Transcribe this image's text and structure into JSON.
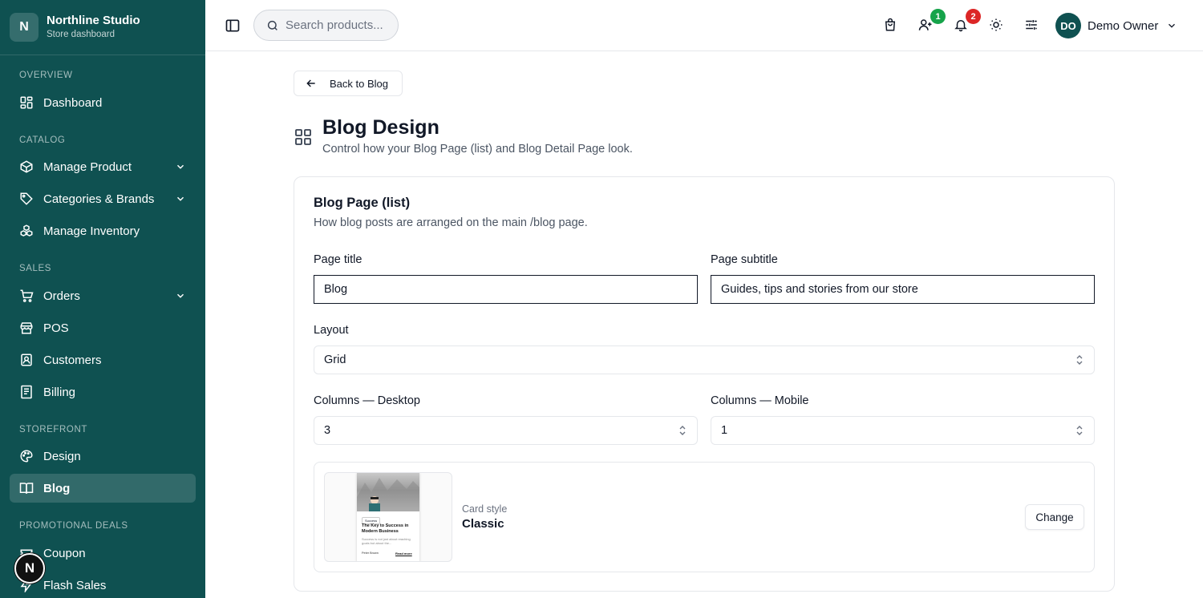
{
  "brand": {
    "logo_letter": "N",
    "name": "Northline Studio",
    "subtitle": "Store dashboard"
  },
  "sidebar": {
    "sections": [
      {
        "label": "OVERVIEW"
      },
      {
        "label": "CATALOG"
      },
      {
        "label": "SALES"
      },
      {
        "label": "STOREFRONT"
      },
      {
        "label": "PROMOTIONAL DEALS"
      }
    ],
    "items": [
      {
        "label": "Dashboard",
        "icon": "dashboard-icon"
      },
      {
        "label": "Manage Product",
        "icon": "package-icon",
        "expandable": true
      },
      {
        "label": "Categories & Brands",
        "icon": "tag-icon",
        "expandable": true
      },
      {
        "label": "Manage Inventory",
        "icon": "boxes-icon"
      },
      {
        "label": "Orders",
        "icon": "cart-icon",
        "expandable": true
      },
      {
        "label": "POS",
        "icon": "store-icon"
      },
      {
        "label": "Customers",
        "icon": "contact-icon"
      },
      {
        "label": "Billing",
        "icon": "receipt-icon"
      },
      {
        "label": "Design",
        "icon": "palette-icon"
      },
      {
        "label": "Blog",
        "icon": "book-icon",
        "active": true
      },
      {
        "label": "Coupon",
        "icon": "ticket-icon"
      },
      {
        "label": "Flash Sales",
        "icon": "zap-icon"
      }
    ],
    "floating_button_letter": "N"
  },
  "header": {
    "search_placeholder": "Search products...",
    "badges": {
      "users": "1",
      "notifications": "2"
    },
    "badge_colors": {
      "users": "#16a34a",
      "notifications": "#dc2626"
    },
    "user": {
      "initials": "DO",
      "name": "Demo Owner"
    }
  },
  "main": {
    "back_label": "Back to Blog",
    "title": "Blog Design",
    "subtitle": "Control how your Blog Page (list) and Blog Detail Page look.",
    "card": {
      "title": "Blog Page (list)",
      "subtitle": "How blog posts are arranged on the main /blog page.",
      "page_title_label": "Page title",
      "page_title_value": "Blog",
      "page_subtitle_label": "Page subtitle",
      "page_subtitle_value": "Guides, tips and stories from our store",
      "layout_label": "Layout",
      "layout_value": "Grid",
      "columns_desktop_label": "Columns — Desktop",
      "columns_desktop_value": "3",
      "columns_mobile_label": "Columns — Mobile",
      "columns_mobile_value": "1",
      "card_style_label": "Card style",
      "card_style_value": "Classic",
      "change_label": "Change",
      "preview": {
        "tag": "Success",
        "title": "The Key to Success in Modern Business",
        "excerpt": "Success is not just about reaching goals but about the...",
        "author": "Peter Brown",
        "read_more": "Read more"
      }
    }
  },
  "colors": {
    "sidebar_bg": "#0f5151",
    "accent": "#0f5151"
  }
}
